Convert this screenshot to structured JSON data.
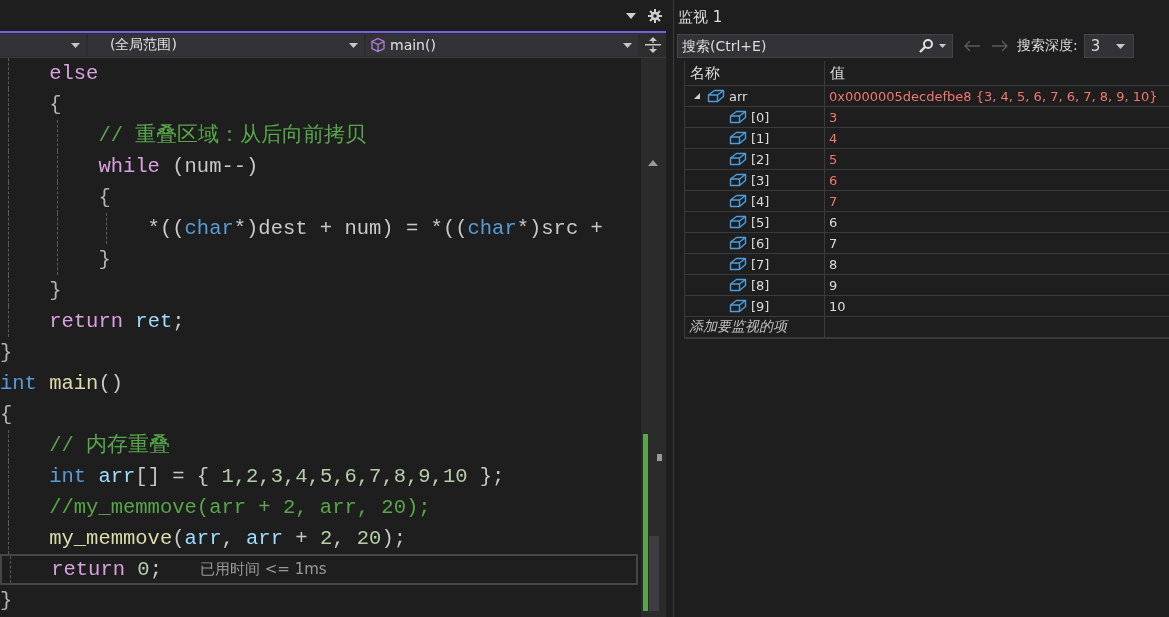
{
  "editor": {
    "nav": [
      {
        "kind": "project"
      },
      {
        "kind": "scope",
        "text": "(全局范围)"
      },
      {
        "kind": "member",
        "text": "main()"
      }
    ],
    "lines": [
      {
        "current": false,
        "tokens": [
          {
            "kind": "kw",
            "text": "    else"
          }
        ]
      },
      {
        "current": false,
        "tokens": [
          {
            "kind": "punct",
            "text": "    {"
          }
        ]
      },
      {
        "current": false,
        "tokens": [
          {
            "kind": "comment",
            "text": "        // 重叠区域：从后向前拷贝"
          }
        ]
      },
      {
        "current": false,
        "tokens": [
          {
            "kind": "kw",
            "text": "        while"
          },
          {
            "kind": "plain",
            "text": " (num--)"
          }
        ]
      },
      {
        "current": false,
        "tokens": [
          {
            "kind": "punct",
            "text": "        {"
          }
        ]
      },
      {
        "current": false,
        "tokens": [
          {
            "kind": "plain",
            "text": "            *(("
          },
          {
            "kind": "type",
            "text": "char"
          },
          {
            "kind": "plain",
            "text": "*)dest + num) = *(("
          },
          {
            "kind": "type",
            "text": "char"
          },
          {
            "kind": "plain",
            "text": "*)src +"
          }
        ]
      },
      {
        "current": false,
        "tokens": [
          {
            "kind": "punct",
            "text": "        }"
          }
        ]
      },
      {
        "current": false,
        "tokens": [
          {
            "kind": "punct",
            "text": "    }"
          }
        ]
      },
      {
        "current": false,
        "tokens": [
          {
            "kind": "kw",
            "text": "    return"
          },
          {
            "kind": "var",
            "text": " ret"
          },
          {
            "kind": "plain",
            "text": ";"
          }
        ]
      },
      {
        "current": false,
        "tokens": [
          {
            "kind": "punct",
            "text": "}"
          }
        ]
      },
      {
        "current": false,
        "tokens": [
          {
            "kind": "type",
            "text": "int"
          },
          {
            "kind": "func",
            "text": " main"
          },
          {
            "kind": "plain",
            "text": "()"
          }
        ]
      },
      {
        "current": false,
        "tokens": [
          {
            "kind": "punct",
            "text": "{"
          }
        ]
      },
      {
        "current": false,
        "tokens": [
          {
            "kind": "comment",
            "text": "    // 内存重叠"
          }
        ]
      },
      {
        "current": false,
        "tokens": [
          {
            "kind": "type",
            "text": "    int"
          },
          {
            "kind": "var",
            "text": " arr"
          },
          {
            "kind": "plain",
            "text": "[] = { "
          },
          {
            "kind": "num",
            "text": "1,2,3,4,5,6,7,8,9,10"
          },
          {
            "kind": "plain",
            "text": " };"
          }
        ]
      },
      {
        "current": false,
        "tokens": [
          {
            "kind": "comment",
            "text": "    //my_memmove(arr + 2, arr, 20);"
          }
        ]
      },
      {
        "current": false,
        "tokens": [
          {
            "kind": "func",
            "text": "    my_memmove"
          },
          {
            "kind": "plain",
            "text": "("
          },
          {
            "kind": "var",
            "text": "arr"
          },
          {
            "kind": "plain",
            "text": ", "
          },
          {
            "kind": "var",
            "text": "arr"
          },
          {
            "kind": "plain",
            "text": " + "
          },
          {
            "kind": "num",
            "text": "2"
          },
          {
            "kind": "plain",
            "text": ", "
          },
          {
            "kind": "num",
            "text": "20"
          },
          {
            "kind": "plain",
            "text": ");"
          }
        ]
      },
      {
        "current": true,
        "tip": "已用时间 <= 1ms",
        "tokens": [
          {
            "kind": "kw",
            "text": "    return"
          },
          {
            "kind": "num",
            "text": " 0"
          },
          {
            "kind": "plain",
            "text": ";"
          }
        ]
      },
      {
        "current": false,
        "tokens": [
          {
            "kind": "punct",
            "text": "}"
          }
        ]
      }
    ]
  },
  "watch": {
    "title": "监视 1",
    "search": {
      "placeholder": "搜索(Ctrl+E)"
    },
    "nav_buttons": [
      {
        "kind": "back",
        "disabled": true
      },
      {
        "kind": "forward",
        "disabled": true
      }
    ],
    "depth": {
      "label": "搜索深度:",
      "value": "3"
    },
    "columns": [
      "名称",
      "值"
    ],
    "rows": [
      {
        "name": "arr",
        "value": "0x0000005decdefbe8 {3, 4, 5, 6, 7, 6, 7, 8, 9, 10}",
        "changed": true,
        "expanded": true,
        "children": [
          {
            "name": "[0]",
            "value": "3",
            "changed": true
          },
          {
            "name": "[1]",
            "value": "4",
            "changed": true
          },
          {
            "name": "[2]",
            "value": "5",
            "changed": true
          },
          {
            "name": "[3]",
            "value": "6",
            "changed": true
          },
          {
            "name": "[4]",
            "value": "7",
            "changed": true
          },
          {
            "name": "[5]",
            "value": "6",
            "changed": false
          },
          {
            "name": "[6]",
            "value": "7",
            "changed": false
          },
          {
            "name": "[7]",
            "value": "8",
            "changed": false
          },
          {
            "name": "[8]",
            "value": "9",
            "changed": false
          },
          {
            "name": "[9]",
            "value": "10",
            "changed": false
          }
        ]
      }
    ],
    "add_hint": "添加要监视的项"
  }
}
